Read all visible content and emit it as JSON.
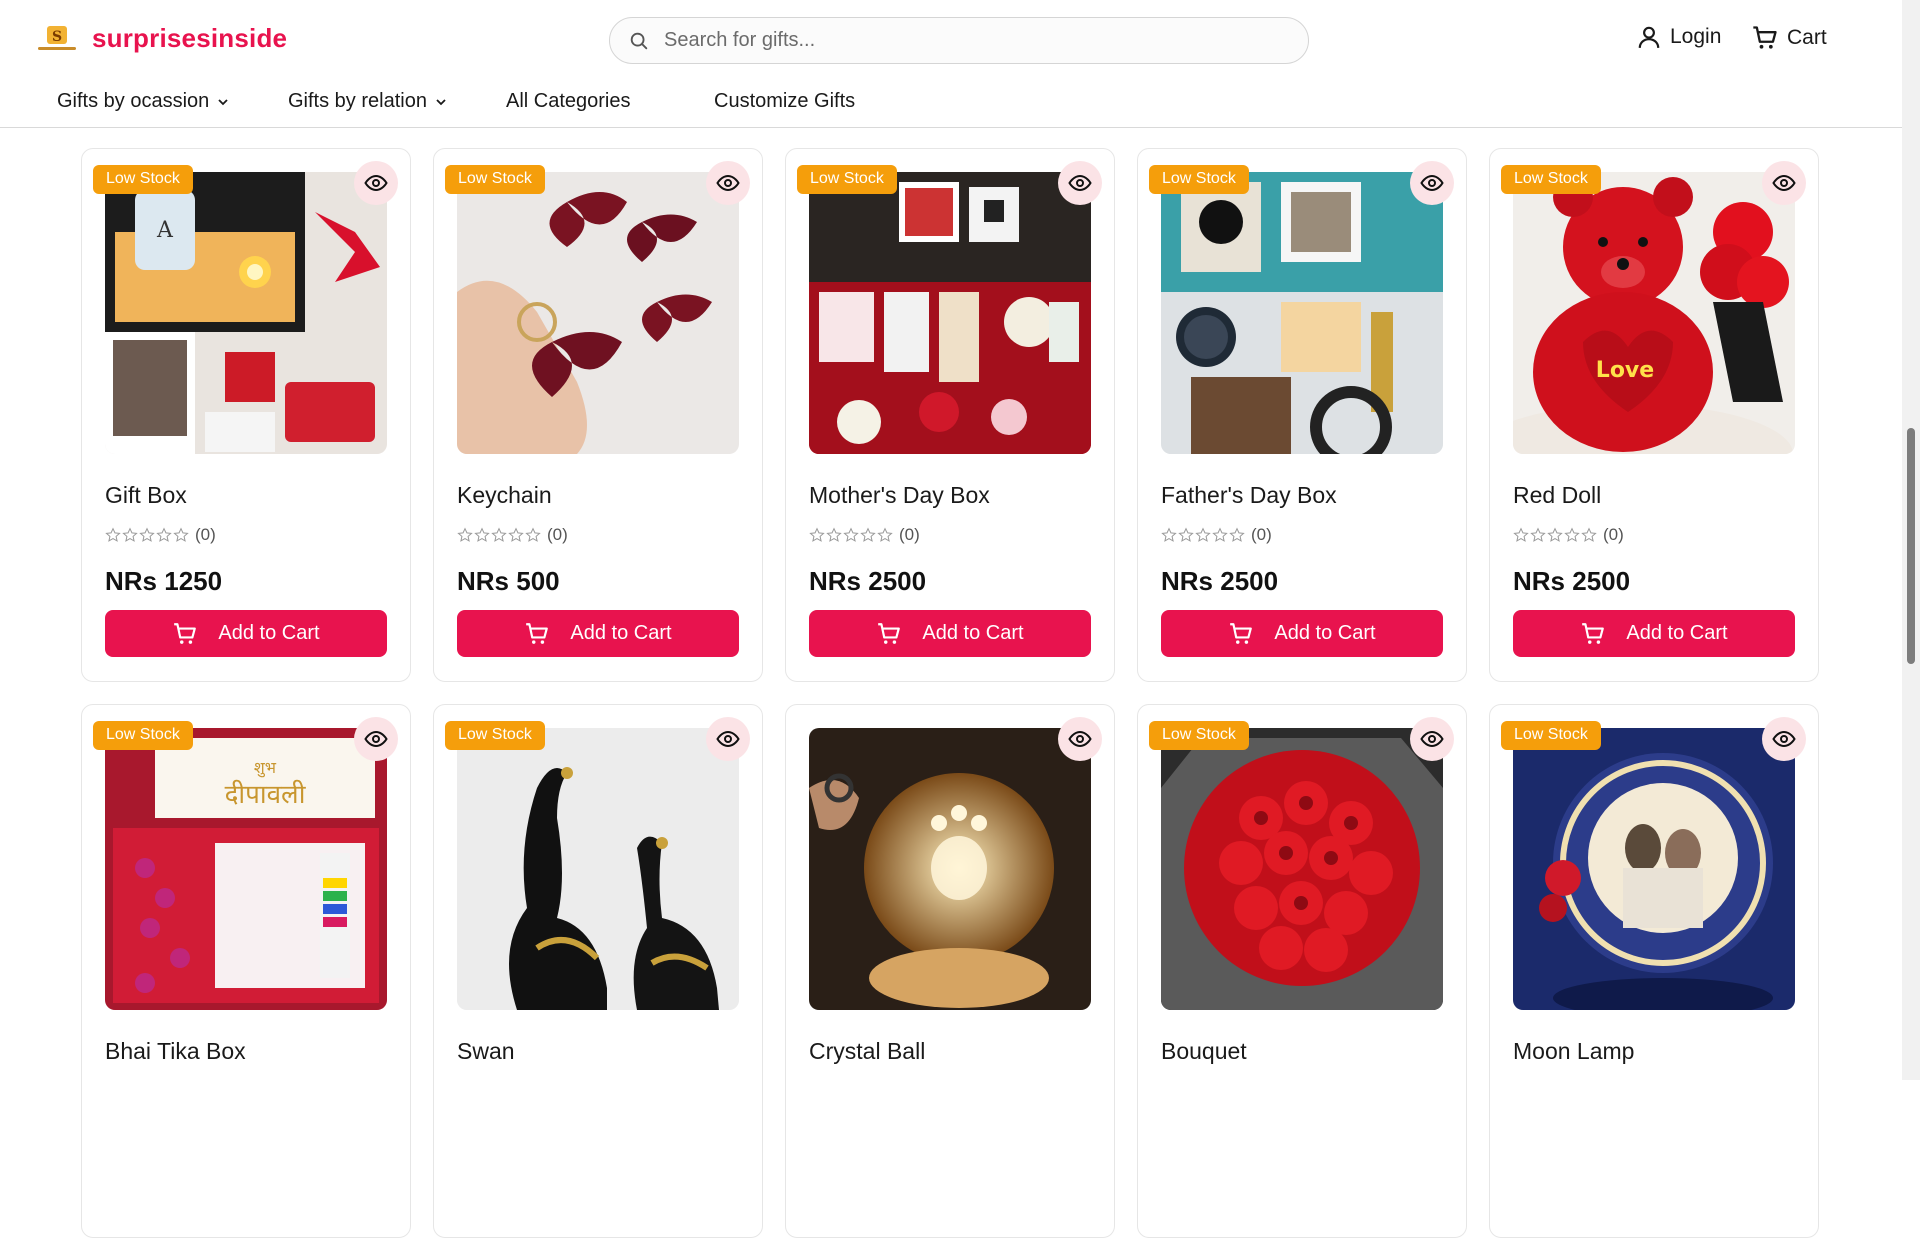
{
  "brand": {
    "name": "surprisesinside",
    "color": "#e8134e"
  },
  "search": {
    "placeholder": "Search for gifts..."
  },
  "header": {
    "login_label": "Login",
    "cart_label": "Cart"
  },
  "nav": {
    "items": [
      {
        "label": "Gifts by ocassion",
        "has_dropdown": true
      },
      {
        "label": "Gifts by relation",
        "has_dropdown": true
      },
      {
        "label": "All Categories",
        "has_dropdown": false
      },
      {
        "label": "Customize Gifts",
        "has_dropdown": false
      }
    ]
  },
  "products": [
    {
      "name": "Gift Box",
      "price": "NRs 1250",
      "rating_count": "(0)",
      "badge": "Low Stock",
      "button": "Add to Cart",
      "image": "gift-box"
    },
    {
      "name": "Keychain",
      "price": "NRs 500",
      "rating_count": "(0)",
      "badge": "Low Stock",
      "button": "Add to Cart",
      "image": "keychain"
    },
    {
      "name": "Mother's Day Box",
      "price": "NRs 2500",
      "rating_count": "(0)",
      "badge": "Low Stock",
      "button": "Add to Cart",
      "image": "mothers-day"
    },
    {
      "name": "Father's Day Box",
      "price": "NRs 2500",
      "rating_count": "(0)",
      "badge": "Low Stock",
      "button": "Add to Cart",
      "image": "fathers-day"
    },
    {
      "name": "Red Doll",
      "price": "NRs 2500",
      "rating_count": "(0)",
      "badge": "Low Stock",
      "button": "Add to Cart",
      "image": "red-doll"
    },
    {
      "name": "Bhai Tika Box",
      "badge": "Low Stock",
      "image": "bhai-tika"
    },
    {
      "name": "Swan",
      "badge": "Low Stock",
      "image": "swan"
    },
    {
      "name": "Crystal Ball",
      "badge": "",
      "image": "crystal-ball"
    },
    {
      "name": "Bouquet",
      "badge": "Low Stock",
      "image": "bouquet"
    },
    {
      "name": "Moon Lamp",
      "badge": "Low Stock",
      "image": "moon-lamp"
    }
  ],
  "colors": {
    "accent": "#e8134e",
    "badge": "#f59e0b",
    "eye_bg": "#fbe3e6"
  }
}
